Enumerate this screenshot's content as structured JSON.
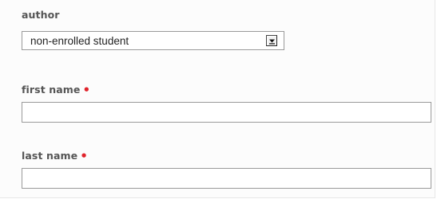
{
  "form": {
    "author": {
      "label": "author",
      "selected_value": "non-enrolled student",
      "dropdown_icon": "chevron-down-icon"
    },
    "first_name": {
      "label": "first name",
      "required_marker": "•",
      "value": ""
    },
    "last_name": {
      "label": "last name",
      "required_marker": "•",
      "value": ""
    }
  },
  "colors": {
    "label": "#555555",
    "required": "#e0232b",
    "input_border": "#9a9a9a"
  }
}
